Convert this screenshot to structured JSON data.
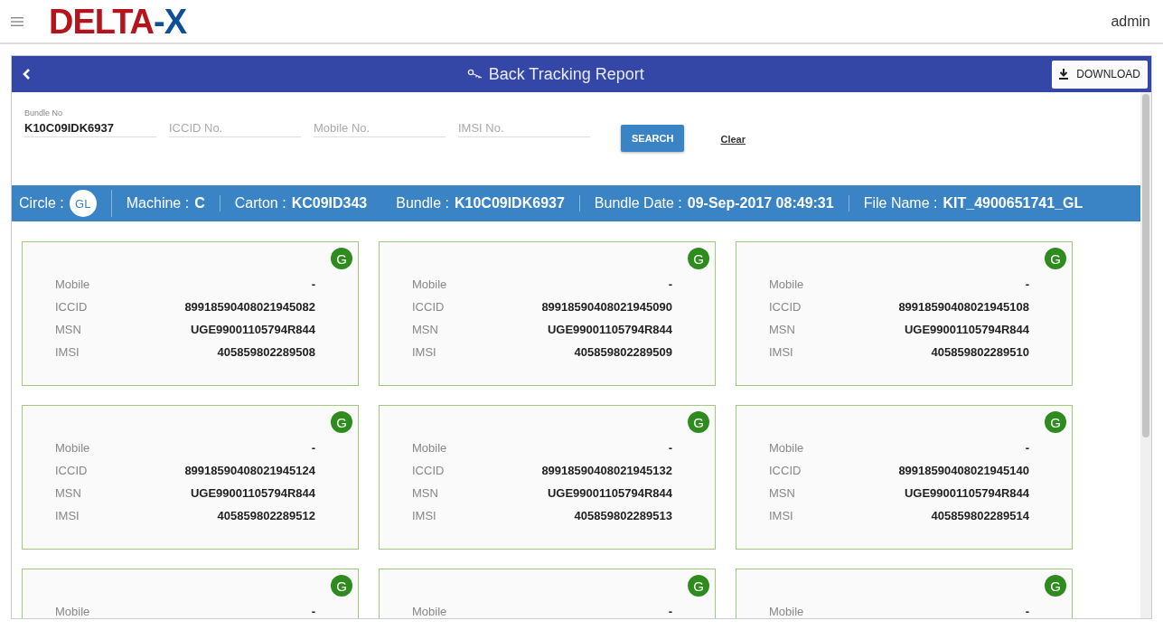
{
  "header": {
    "logo": {
      "main": "DELTA",
      "accent": "-X"
    },
    "user": "admin"
  },
  "report": {
    "title": "Back Tracking Report",
    "download": "DOWNLOAD",
    "fields": [
      {
        "label": "Bundle No",
        "value": "K10C09IDK6937"
      },
      {
        "placeholder": "ICCID No."
      },
      {
        "placeholder": "Mobile No."
      },
      {
        "placeholder": "IMSI No."
      }
    ],
    "search": "SEARCH",
    "clear": "Clear",
    "info": [
      {
        "kind": "badge",
        "label": "Circle :",
        "value": "GL",
        "separator": true
      },
      {
        "kind": "text",
        "label": "Machine :",
        "value": "C",
        "separator": true
      },
      {
        "kind": "text",
        "label": "Carton :",
        "value": "KC09ID343",
        "separator": false
      },
      {
        "kind": "text",
        "label": "Bundle :",
        "value": "K10C09IDK6937",
        "separator": true
      },
      {
        "kind": "text",
        "label": "Bundle Date :",
        "value": "09-Sep-2017 08:49:31",
        "separator": true
      },
      {
        "kind": "text",
        "label": "File Name :",
        "value": "KIT_4900651741_GL",
        "separator": false
      }
    ],
    "cards": [
      {
        "badge": "G",
        "rows": [
          {
            "label": "Mobile",
            "value": "-"
          },
          {
            "label": "ICCID",
            "value": "89918590408021945082"
          },
          {
            "label": "MSN",
            "value": "UGE99001105794R844"
          },
          {
            "label": "IMSI",
            "value": "405859802289508"
          }
        ]
      },
      {
        "badge": "G",
        "rows": [
          {
            "label": "Mobile",
            "value": "-"
          },
          {
            "label": "ICCID",
            "value": "89918590408021945090"
          },
          {
            "label": "MSN",
            "value": "UGE99001105794R844"
          },
          {
            "label": "IMSI",
            "value": "405859802289509"
          }
        ]
      },
      {
        "badge": "G",
        "rows": [
          {
            "label": "Mobile",
            "value": "-"
          },
          {
            "label": "ICCID",
            "value": "89918590408021945108"
          },
          {
            "label": "MSN",
            "value": "UGE99001105794R844"
          },
          {
            "label": "IMSI",
            "value": "405859802289510"
          }
        ]
      },
      {
        "badge": "G",
        "rows": [
          {
            "label": "Mobile",
            "value": "-"
          },
          {
            "label": "ICCID",
            "value": "89918590408021945124"
          },
          {
            "label": "MSN",
            "value": "UGE99001105794R844"
          },
          {
            "label": "IMSI",
            "value": "405859802289512"
          }
        ]
      },
      {
        "badge": "G",
        "rows": [
          {
            "label": "Mobile",
            "value": "-"
          },
          {
            "label": "ICCID",
            "value": "89918590408021945132"
          },
          {
            "label": "MSN",
            "value": "UGE99001105794R844"
          },
          {
            "label": "IMSI",
            "value": "405859802289513"
          }
        ]
      },
      {
        "badge": "G",
        "rows": [
          {
            "label": "Mobile",
            "value": "-"
          },
          {
            "label": "ICCID",
            "value": "89918590408021945140"
          },
          {
            "label": "MSN",
            "value": "UGE99001105794R844"
          },
          {
            "label": "IMSI",
            "value": "405859802289514"
          }
        ]
      },
      {
        "badge": "G",
        "rows": [
          {
            "label": "Mobile",
            "value": "-"
          }
        ]
      },
      {
        "badge": "G",
        "rows": [
          {
            "label": "Mobile",
            "value": "-"
          }
        ]
      },
      {
        "badge": "G",
        "rows": [
          {
            "label": "Mobile",
            "value": "-"
          }
        ]
      }
    ]
  }
}
